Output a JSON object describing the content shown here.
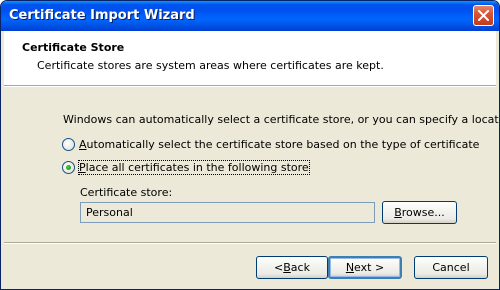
{
  "window": {
    "title": "Certificate Import Wizard"
  },
  "header": {
    "title": "Certificate Store",
    "description": "Certificate stores are system areas where certificates are kept."
  },
  "body": {
    "intro": "Windows can automatically select a certificate store, or you can specify a location for",
    "options": [
      {
        "label": "Automatically select the certificate store based on the type of certificate",
        "selected": false,
        "accel": "U"
      },
      {
        "label": "Place all certificates in the following store",
        "selected": true,
        "accel": "P"
      }
    ],
    "store_label": "Certificate store:",
    "store_value": "Personal",
    "browse_label": "Browse..."
  },
  "footer": {
    "back_label": "< Back",
    "next_label": "Next >",
    "cancel_label": "Cancel"
  },
  "colors": {
    "titlebar": "#0054e3",
    "dialog_bg": "#ece9d8",
    "header_bg": "#ffffff",
    "close_button": "#c23c1d"
  }
}
